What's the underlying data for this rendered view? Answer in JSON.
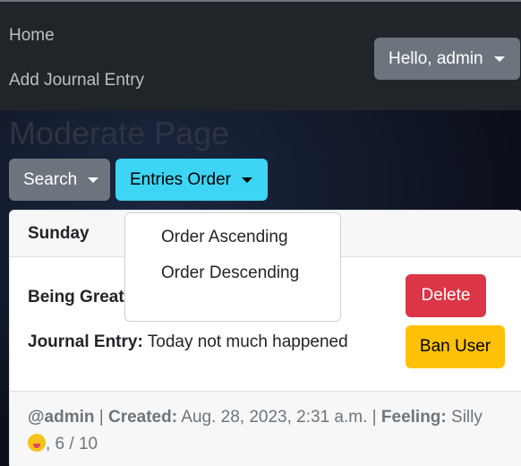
{
  "nav": {
    "home": "Home",
    "add_entry": "Add Journal Entry",
    "user_menu": "Hello, admin"
  },
  "page": {
    "title": "Moderate Page"
  },
  "toolbar": {
    "search_label": "Search",
    "order_label": "Entries Order"
  },
  "order_dropdown": {
    "items": [
      "Order Ascending",
      "Order Descending"
    ]
  },
  "entry": {
    "day": "Sunday",
    "title": "Being Great",
    "journal_label": "Journal Entry:",
    "journal_text": "Today not much happened",
    "delete_label": "Delete",
    "ban_label": "Ban User",
    "author": "@admin",
    "created_label": "Created:",
    "created_value": "Aug. 28, 2023, 2:31 a.m.",
    "feeling_label": "Feeling:",
    "feeling_value": "Silly",
    "score": ", 6 / 10",
    "separator": "|"
  },
  "colors": {
    "navbar": "#212529",
    "secondary": "#6c757d",
    "info": "#3dd5f3",
    "danger": "#dc3545",
    "warning": "#ffc107"
  },
  "icons": {
    "feeling": "silly-face-emoji-icon",
    "caret": "caret-down-icon"
  }
}
